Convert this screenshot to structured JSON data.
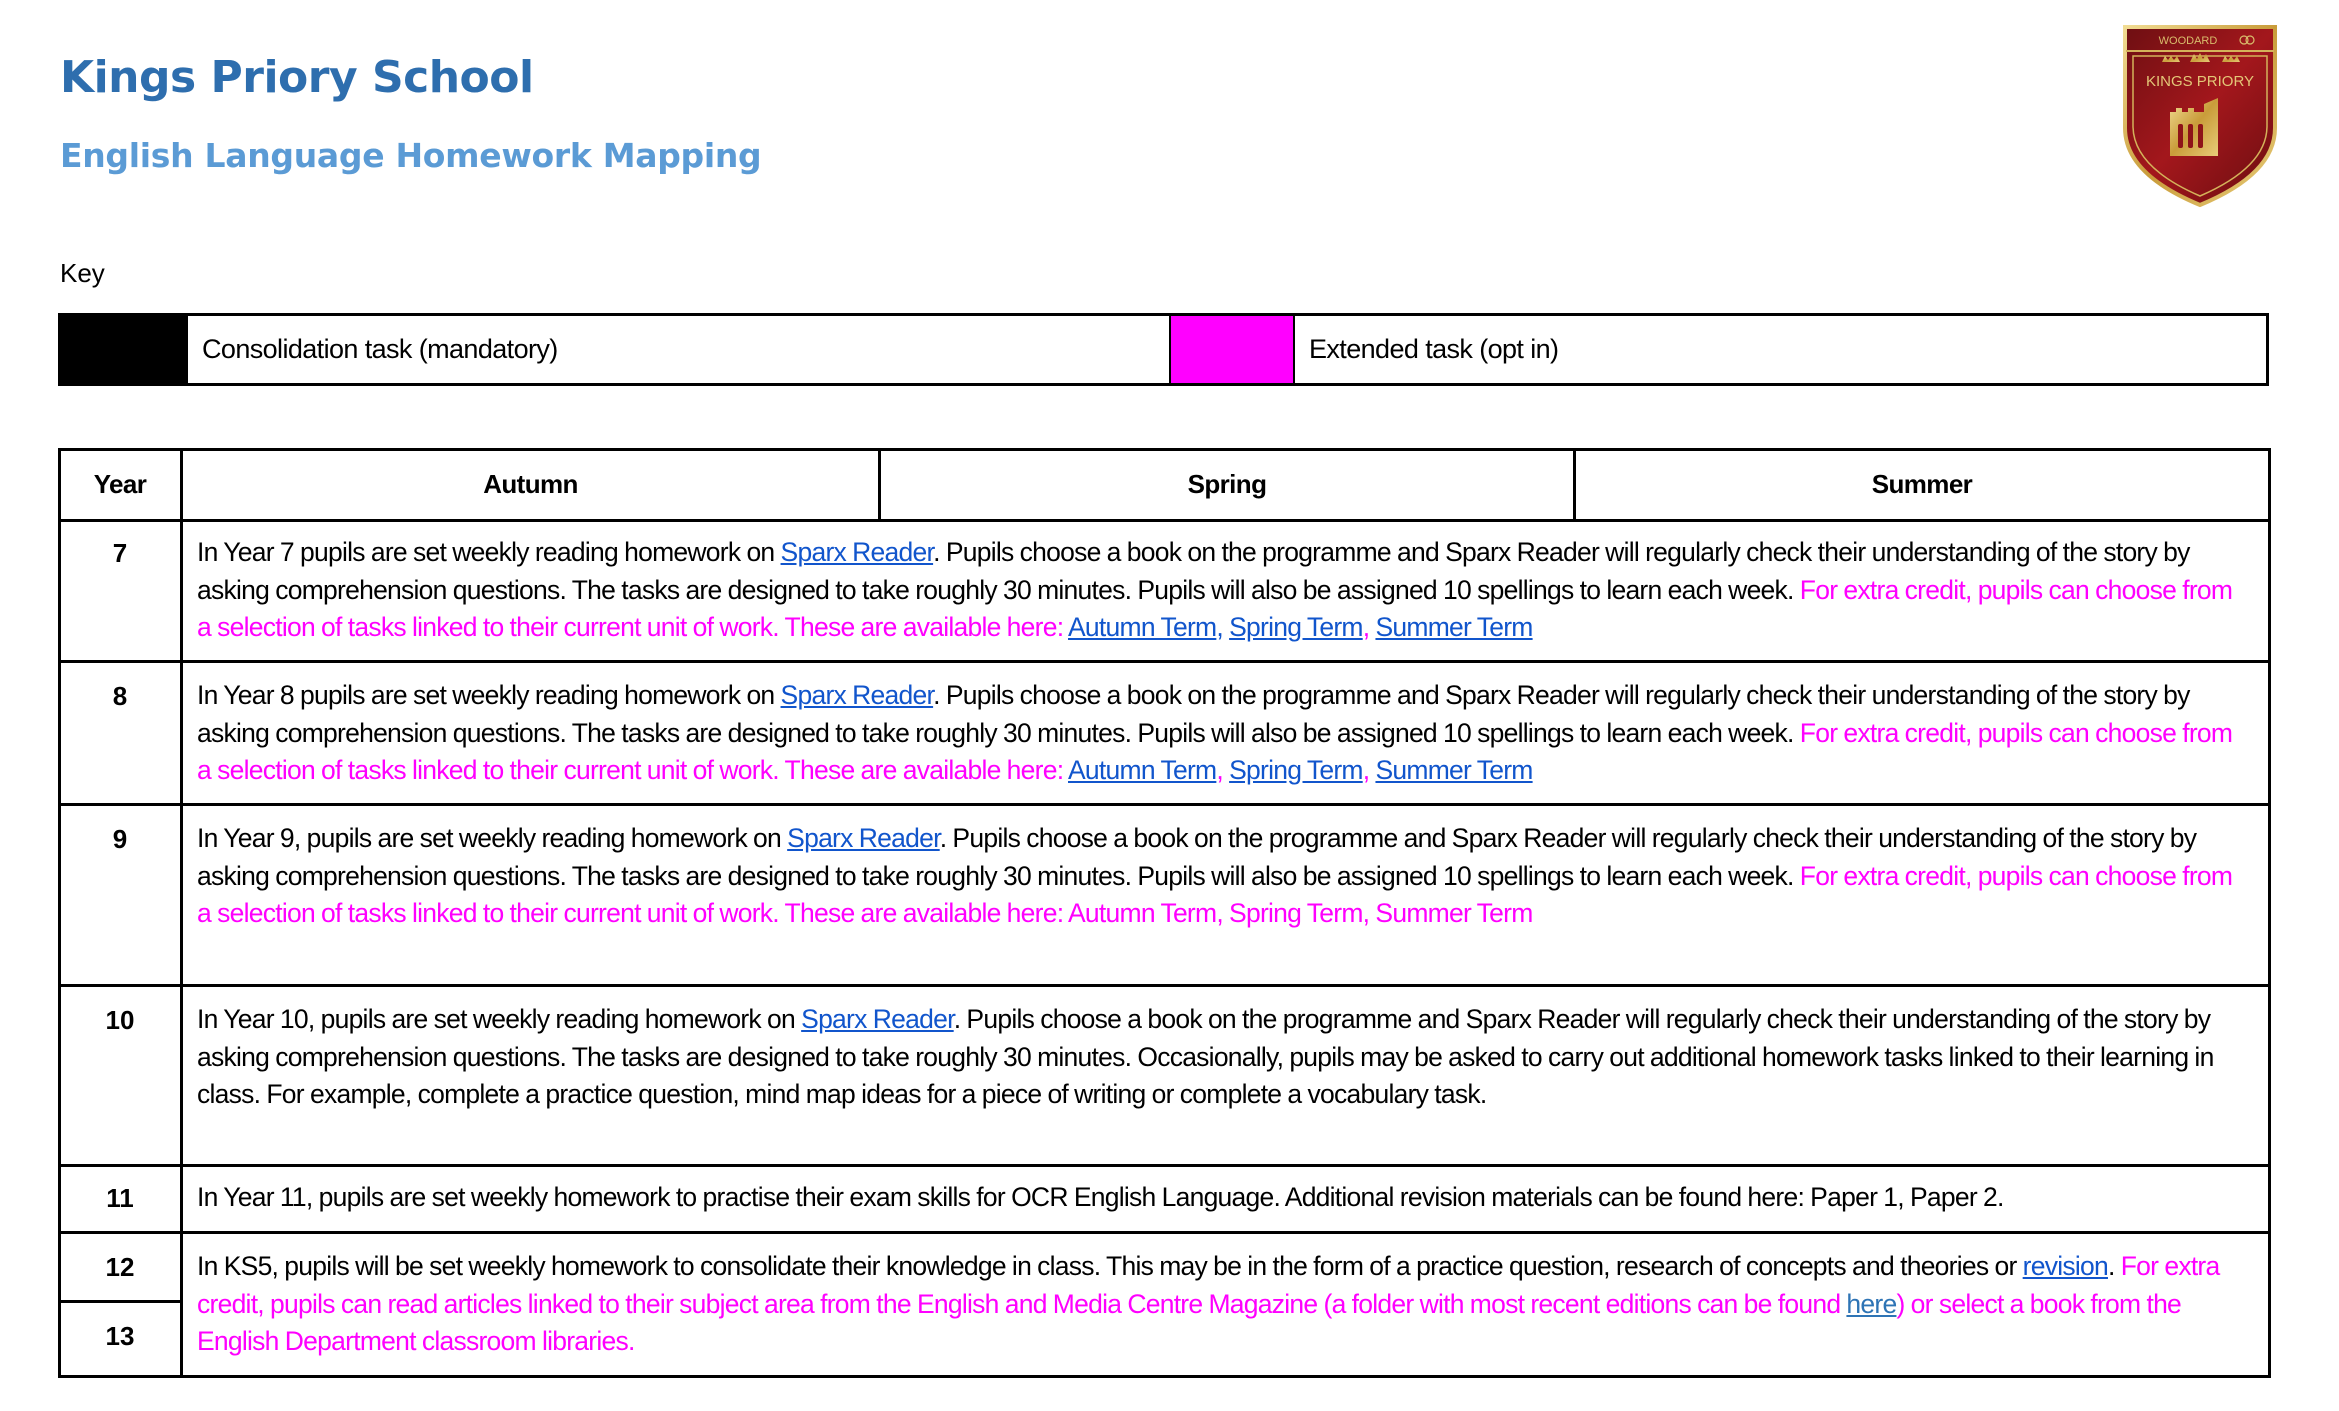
{
  "header": {
    "title": "Kings Priory School",
    "subtitle": "English Language Homework Mapping",
    "logo": {
      "top_text": "WOODARD",
      "name": "KINGS PRIORY",
      "colors": {
        "shield": "#8b1a1a",
        "gold": "#d4b25a"
      }
    }
  },
  "key": {
    "label": "Key",
    "items": [
      {
        "swatch_color": "#000000",
        "label": "Consolidation task (mandatory)"
      },
      {
        "swatch_color": "#ff00ff",
        "label": "Extended task (opt in)"
      }
    ]
  },
  "colors": {
    "title": "#2e6eae",
    "subtitle": "#5b9bd5",
    "extended": "#ff00ff",
    "link": "#1155cc"
  },
  "table": {
    "headers": [
      "Year",
      "Autumn",
      "Spring",
      "Summer"
    ],
    "rows": [
      {
        "year": "7",
        "segments": [
          {
            "t": "In Year 7 pupils are set weekly reading homework on ",
            "s": "plain"
          },
          {
            "t": "Sparx Reader",
            "s": "link"
          },
          {
            "t": ". Pupils choose a book on the programme and Sparx Reader will regularly check their understanding of the story by asking comprehension questions. The tasks are designed to take roughly 30 minutes. Pupils will also be assigned 10 spellings to learn each week.  ",
            "s": "plain"
          },
          {
            "t": "For extra credit, pupils can choose from a selection of tasks linked to their current unit of work. These are available here: ",
            "s": "pink"
          },
          {
            "t": "Autumn Term",
            "s": "link"
          },
          {
            "t": ", ",
            "s": "link-plain"
          },
          {
            "t": "Spring Term",
            "s": "link"
          },
          {
            "t": ", ",
            "s": "pink"
          },
          {
            "t": "Summer Term",
            "s": "link"
          }
        ]
      },
      {
        "year": "8",
        "segments": [
          {
            "t": "In Year 8 pupils are set weekly reading homework on ",
            "s": "plain"
          },
          {
            "t": "Sparx Reader",
            "s": "link"
          },
          {
            "t": ". Pupils choose a book on the programme and Sparx Reader will regularly check their understanding of the story by asking comprehension questions. The tasks are designed to take roughly 30 minutes. Pupils will also be assigned 10 spellings to learn each week. ",
            "s": "plain"
          },
          {
            "t": "For extra credit, pupils can choose from a selection of tasks linked to their current unit of work. These are available here: ",
            "s": "pink"
          },
          {
            "t": "Autumn Term",
            "s": "link"
          },
          {
            "t": ", ",
            "s": "pink"
          },
          {
            "t": "Spring Term",
            "s": "link"
          },
          {
            "t": ", ",
            "s": "pink"
          },
          {
            "t": "Summer Term",
            "s": "link"
          }
        ]
      },
      {
        "year": "9",
        "segments": [
          {
            "t": "In Year 9, pupils are set weekly reading homework on ",
            "s": "plain"
          },
          {
            "t": "Sparx Reader",
            "s": "link"
          },
          {
            "t": ". Pupils choose a book on the programme and Sparx Reader will regularly check their understanding of the story by asking comprehension questions. The tasks are designed to take roughly 30 minutes. Pupils will also be assigned 10 spellings to learn each week. ",
            "s": "plain"
          },
          {
            "t": "For extra credit, pupils can choose from a selection of tasks linked to their current unit of work. These are available here: Autumn Term, Spring Term, Summer Term",
            "s": "pink"
          }
        ]
      },
      {
        "year": "10",
        "segments": [
          {
            "t": "In Year 10, pupils are set weekly reading homework on ",
            "s": "plain"
          },
          {
            "t": "Sparx Reader",
            "s": "link"
          },
          {
            "t": ". Pupils choose a book on the programme and Sparx Reader will regularly check their understanding of the story by asking comprehension questions. The tasks are designed to take roughly 30 minutes. Occasionally, pupils may be asked to carry out additional homework tasks linked to their learning in class. For example, complete a practice question, mind map ideas for a piece of writing or complete a vocabulary task.",
            "s": "plain"
          }
        ]
      },
      {
        "year": "11",
        "segments": [
          {
            "t": "In Year 11, pupils are set weekly homework to practise their exam skills for OCR English Language. Additional revision materials can be found here: Paper 1, Paper 2.",
            "s": "plain"
          }
        ]
      },
      {
        "year": "12",
        "year2": "13",
        "segments": [
          {
            "t": "In KS5, pupils will be set weekly homework to consolidate their knowledge in class. This may be in the form of a practice question, research of concepts and theories or ",
            "s": "plain"
          },
          {
            "t": "revision",
            "s": "link"
          },
          {
            "t": ". ",
            "s": "plain"
          },
          {
            "t": "For extra credit, pupils can read articles linked to their subject area from the English and Media Centre Magazine (a folder with most recent editions can be found ",
            "s": "pink"
          },
          {
            "t": "here",
            "s": "link2"
          },
          {
            "t": ") or select a book from the English Department classroom libraries.",
            "s": "pink"
          }
        ]
      }
    ]
  }
}
